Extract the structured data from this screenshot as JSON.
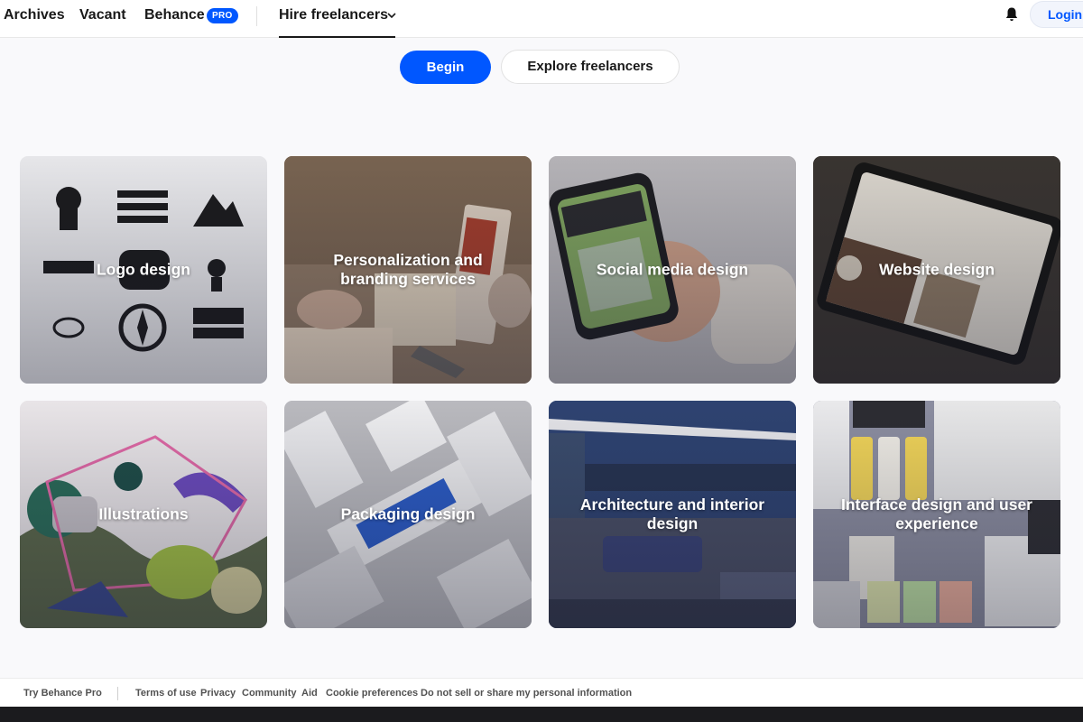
{
  "nav": {
    "archives": "Archives",
    "vacant": "Vacant",
    "behance": "Behance",
    "pro_badge": "PRO",
    "hire": "Hire freelancers",
    "login": "Login"
  },
  "hero": {
    "begin": "Begin",
    "explore": "Explore freelancers"
  },
  "categories": [
    {
      "label": "Logo design"
    },
    {
      "label": "Personalization and branding services"
    },
    {
      "label": "Social media design"
    },
    {
      "label": "Website design"
    },
    {
      "label": "Illustrations"
    },
    {
      "label": "Packaging design"
    },
    {
      "label": "Architecture and interior design"
    },
    {
      "label": "Interface design and user experience"
    }
  ],
  "footer": {
    "try_pro": "Try Behance Pro",
    "terms": "Terms of use",
    "privacy": "Privacy",
    "community": "Community",
    "aid": "Aid",
    "cookie": "Cookie preferences",
    "do_not_sell": "Do not sell or share my personal information"
  },
  "icons": {
    "bell": "bell-icon",
    "chevron": "chevron-down-icon"
  },
  "colors": {
    "accent": "#0057ff",
    "text": "#191919"
  }
}
